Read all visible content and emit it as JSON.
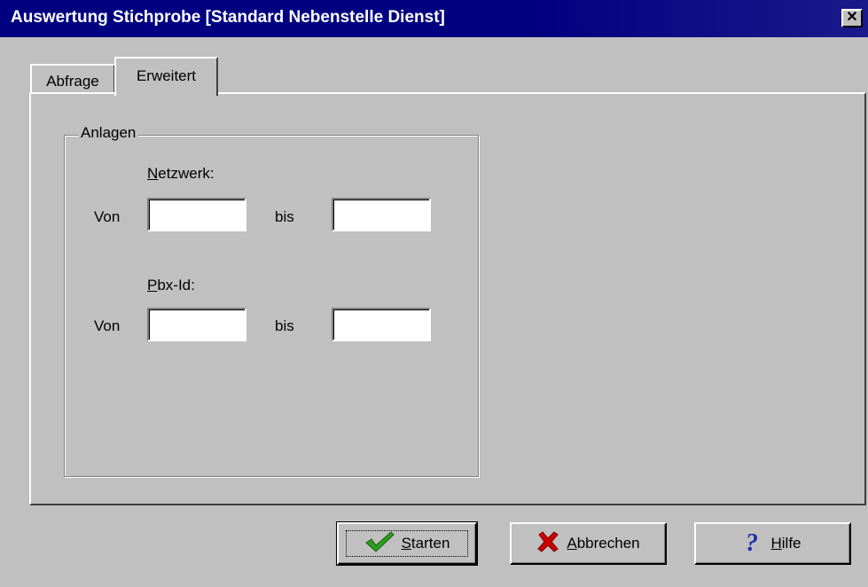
{
  "window": {
    "title": "Auswertung Stichprobe [Standard Nebenstelle Dienst]",
    "close_label": "✕"
  },
  "tabs": [
    {
      "label": "Abfrage",
      "active": false
    },
    {
      "label": "Erweitert",
      "active": true
    }
  ],
  "group": {
    "title": "Anlagen",
    "netzwerk": {
      "heading": "Netzwerk:",
      "from_label": "Von",
      "to_label": "bis",
      "from_value": "",
      "to_value": ""
    },
    "pbx": {
      "heading": "Pbx-Id:",
      "from_label": "Von",
      "to_label": "bis",
      "from_value": "",
      "to_value": ""
    }
  },
  "buttons": {
    "start": {
      "label": "Starten",
      "icon": "checkmark-icon"
    },
    "cancel": {
      "label": "Abbrechen",
      "icon": "red-x-icon"
    },
    "help": {
      "label": "Hilfe",
      "icon": "question-mark-icon"
    }
  },
  "colors": {
    "titlebar": "#000080",
    "face": "#c0c0c0",
    "check": "#2e9c1f",
    "cross": "#cc0000",
    "help": "#1a2fa8"
  }
}
